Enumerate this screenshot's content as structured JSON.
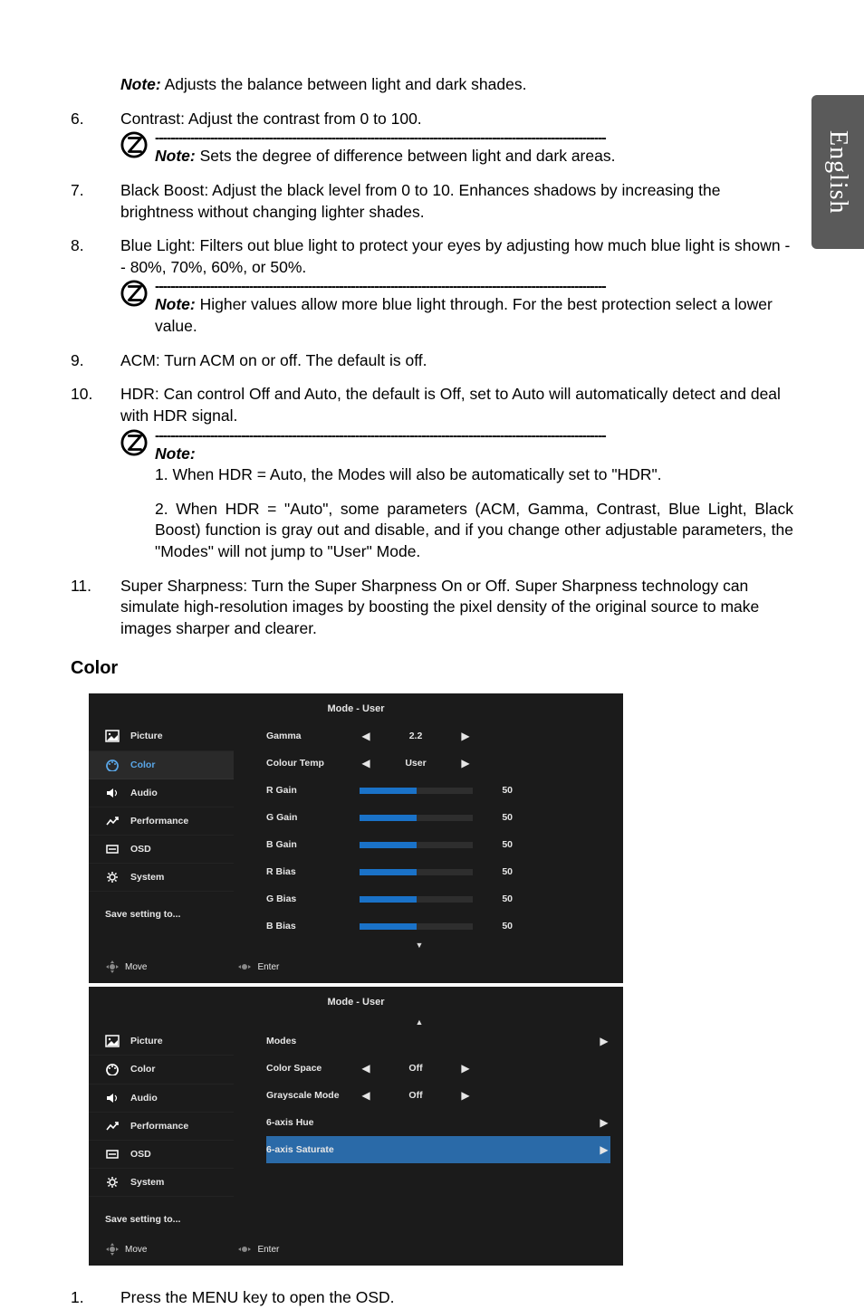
{
  "side_tab": "English",
  "intro_note": {
    "label": "Note:",
    "text": " Adjusts the balance between light and dark shades."
  },
  "items": {
    "i6": {
      "num": "6.",
      "text": "Contrast: Adjust the contrast from 0 to 100.",
      "note_label": "Note:",
      "note_text": " Sets the degree of difference between light and dark areas."
    },
    "i7": {
      "num": "7.",
      "text": "Black Boost: Adjust the black level from 0 to 10. Enhances shadows by increasing the brightness without changing lighter shades."
    },
    "i8": {
      "num": "8.",
      "text": "Blue Light: Filters out blue light to protect your eyes by adjusting how much blue light is shown -- 80%, 70%, 60%, or 50%.",
      "note_label": "Note:",
      "note_text": " Higher values allow more blue light through. For the best protection select a lower value."
    },
    "i9": {
      "num": "9.",
      "text": "ACM: Turn ACM on or off. The default is off."
    },
    "i10": {
      "num": "10.",
      "text": "HDR: Can control Off and Auto, the default is Off, set to Auto will automatically detect and deal with HDR signal.",
      "note_label": "Note:",
      "n1": "1. When HDR = Auto, the Modes will also be automatically set to \"HDR\".",
      "n2": "2. When HDR = \"Auto\", some parameters (ACM, Gamma, Contrast, Blue Light, Black Boost) function is gray out and disable, and if you change other adjustable parameters, the \"Modes\" will not jump to \"User\" Mode."
    },
    "i11": {
      "num": "11.",
      "text": "Super Sharpness: Turn the Super Sharpness On or Off. Super Sharpness technology can simulate high-resolution images by boosting the pixel density of the original source to make images sharper and clearer."
    }
  },
  "section_heading": "Color",
  "osd": {
    "mode_title": "Mode - User",
    "nav": [
      "Picture",
      "Color",
      "Audio",
      "Performance",
      "OSD",
      "System"
    ],
    "save": "Save setting to...",
    "footer_move": "Move",
    "footer_enter": "Enter",
    "panel1": {
      "rows": [
        {
          "label": "Gamma",
          "type": "arrow",
          "value": "2.2"
        },
        {
          "label": "Colour Temp",
          "type": "arrow",
          "value": "User"
        },
        {
          "label": "R Gain",
          "type": "slider",
          "value": "50"
        },
        {
          "label": "G Gain",
          "type": "slider",
          "value": "50"
        },
        {
          "label": "B Gain",
          "type": "slider",
          "value": "50"
        },
        {
          "label": "R Bias",
          "type": "slider",
          "value": "50"
        },
        {
          "label": "G Bias",
          "type": "slider",
          "value": "50"
        },
        {
          "label": "B Bias",
          "type": "slider",
          "value": "50"
        }
      ]
    },
    "panel2": {
      "rows": [
        {
          "label": "Modes",
          "type": "right"
        },
        {
          "label": "Color Space",
          "type": "arrow",
          "value": "Off"
        },
        {
          "label": "Grayscale Mode",
          "type": "arrow",
          "value": "Off"
        },
        {
          "label": "6-axis Hue",
          "type": "right"
        },
        {
          "label": "6-axis Saturate",
          "type": "right",
          "selected": true
        }
      ]
    }
  },
  "footer_step": {
    "num": "1.",
    "text": "Press the MENU key to open the OSD."
  },
  "dash_line": "‑‑‑‑‑‑‑‑‑‑‑‑‑‑‑‑‑‑‑‑‑‑‑‑‑‑‑‑‑‑‑‑‑‑‑‑‑‑‑‑‑‑‑‑‑‑‑‑‑‑‑‑‑‑‑‑‑‑‑‑‑‑‑‑‑‑‑‑‑‑‑‑‑‑‑‑‑‑‑‑‑‑‑‑‑‑‑‑‑‑‑‑‑‑‑‑‑‑‑‑‑‑‑‑‑‑‑‑‑‑‑‑‑‑‑"
}
